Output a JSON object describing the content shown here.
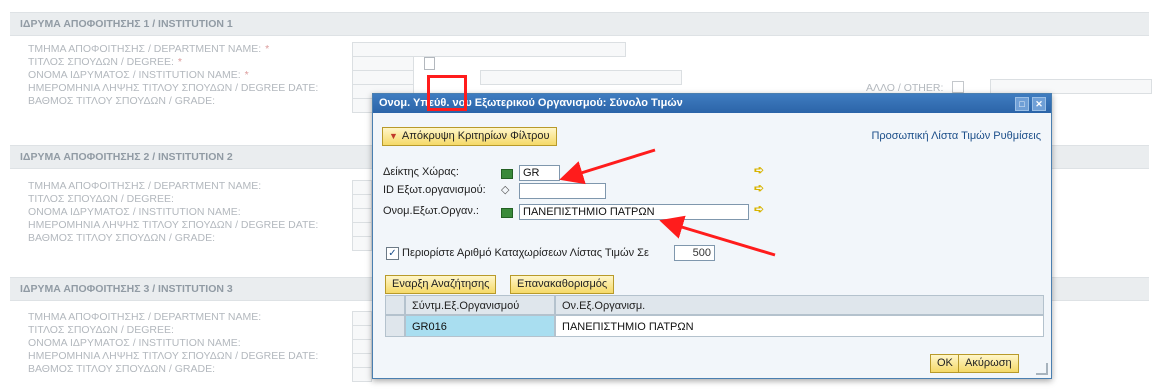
{
  "background_form": {
    "sections": [
      {
        "title": "ΙΔΡΥΜΑ ΑΠΟΦΟΙΤΗΣΗΣ 1 / INSTITUTION 1",
        "rows": [
          "ΤΜΗΜΑ ΑΠΟΦΟΙΤΗΣΗΣ / DEPARTMENT NAME:",
          "ΤΙΤΛΟΣ ΣΠΟΥΔΩΝ / DEGREE:",
          "ΟΝΟΜΑ ΙΔΡΥΜΑΤΟΣ / INSTITUTION NAME:",
          "ΗΜΕΡΟΜΗΝΙΑ ΛΗΨΗΣ ΤΙΤΛΟΥ ΣΠΟΥΔΩΝ / DEGREE DATE:",
          "ΒΑΘΜΟΣ ΤΙΤΛΟΥ ΣΠΟΥΔΩΝ / GRADE:"
        ],
        "required_marker": "*"
      },
      {
        "title": "ΙΔΡΥΜΑ ΑΠΟΦΟΙΤΗΣΗΣ 2 / INSTITUTION 2",
        "rows": [
          "ΤΜΗΜΑ ΑΠΟΦΟΙΤΗΣΗΣ / DEPARTMENT NAME:",
          "ΤΙΤΛΟΣ ΣΠΟΥΔΩΝ / DEGREE:",
          "ΟΝΟΜΑ ΙΔΡΥΜΑΤΟΣ / INSTITUTION NAME:",
          "ΗΜΕΡΟΜΗΝΙΑ ΛΗΨΗΣ ΤΙΤΛΟΥ ΣΠΟΥΔΩΝ / DEGREE DATE:",
          "ΒΑΘΜΟΣ ΤΙΤΛΟΥ ΣΠΟΥΔΩΝ / GRADE:"
        ]
      },
      {
        "title": "ΙΔΡΥΜΑ ΑΠΟΦΟΙΤΗΣΗΣ 3 / INSTITUTION 3",
        "rows": [
          "ΤΜΗΜΑ ΑΠΟΦΟΙΤΗΣΗΣ / DEPARTMENT NAME:",
          "ΤΙΤΛΟΣ ΣΠΟΥΔΩΝ / DEGREE:",
          "ΟΝΟΜΑ ΙΔΡΥΜΑΤΟΣ / INSTITUTION NAME:",
          "ΗΜΕΡΟΜΗΝΙΑ ΛΗΨΗΣ ΤΙΤΛΟΥ ΣΠΟΥΔΩΝ / DEGREE DATE:",
          "ΒΑΘΜΟΣ ΤΙΤΛΟΥ ΣΠΟΥΔΩΝ / GRADE:"
        ]
      }
    ],
    "other_label": "ΑΛΛΟ / OTHER:"
  },
  "dialog": {
    "title": "Ονομ. Υπεύθ. νου Εξωτερικού Οργανισμού: Σύνολο Τιμών",
    "hide_criteria_label": "Απόκρυψη Κριτηρίων Φίλτρου",
    "personal_list_link": "Προσωπική Λίστα Τιμών Ρυθμίσεις",
    "criteria": [
      {
        "label": "Δείκτης Χώρας:",
        "operator": "green",
        "value": "GR"
      },
      {
        "label": "ID Εξωτ.οργανισμού:",
        "operator": "diamond",
        "value": ""
      },
      {
        "label": "Ονομ.Εξωτ.Οργαν.:",
        "operator": "green",
        "value": "ΠΑΝΕΠΙΣΤΗΜΙΟ ΠΑΤΡΩΝ"
      }
    ],
    "limit_label": "Περιορίστε Αριθμό Καταχωρίσεων Λίστας Τιμών Σε",
    "limit_value": "500",
    "limit_checked": "✓",
    "search_button": "Εναρξη Αναζήτησης",
    "reset_button": "Επανακαθορισμός",
    "table": {
      "columns": [
        "Σύντμ.Εξ.Οργανισμού",
        "Ον.Εξ.Οργανισμ."
      ],
      "rows": [
        [
          "GR016",
          "ΠΑΝΕΠΙΣΤΗΜΙΟ ΠΑΤΡΩΝ"
        ]
      ]
    },
    "ok_button": "OK",
    "cancel_button": "Ακύρωση"
  },
  "colors": {
    "annotation": "#ff1c1c",
    "titlebar": "#2b64a8",
    "button": "#f5d968",
    "selected_cell": "#a9def0"
  }
}
